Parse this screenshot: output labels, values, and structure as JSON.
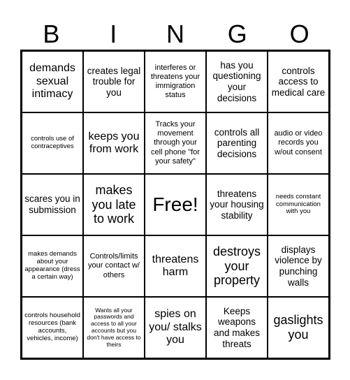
{
  "header": {
    "letters": [
      "B",
      "I",
      "N",
      "G",
      "O"
    ]
  },
  "board": {
    "rows": [
      [
        {
          "text": "demands sexual intimacy"
        },
        {
          "text": "creates legal trouble for you"
        },
        {
          "text": "interferes or threatens your immigration status"
        },
        {
          "text": "has you questioning your decisions"
        },
        {
          "text": "controls access to medical care"
        }
      ],
      [
        {
          "text": "controls use of contraceptives"
        },
        {
          "text": "keeps you from work"
        },
        {
          "text": "Tracks your movement through your cell phone \"for your safety\""
        },
        {
          "text": "controls all parenting decisions"
        },
        {
          "text": "audio or video records you w/out consent"
        }
      ],
      [
        {
          "text": "scares you in submission"
        },
        {
          "text": "makes you late to work"
        },
        {
          "text": "Free!"
        },
        {
          "text": "threatens your housing stability"
        },
        {
          "text": "needs constant communication with you"
        }
      ],
      [
        {
          "text": "makes demands about your appearance (dress a certain way)"
        },
        {
          "text": "Controls/limits your contact w/ others"
        },
        {
          "text": "threatens harm"
        },
        {
          "text": "destroys your property"
        },
        {
          "text": "displays violence by punching walls"
        }
      ],
      [
        {
          "text": "controls household resources (bank accounts, vehicles, income)"
        },
        {
          "text": "Wants all your passwords and access to all your accounts but you don't have access to theirs"
        },
        {
          "text": "spies on you/ stalks you"
        },
        {
          "text": "Keeps weapons and makes threats"
        },
        {
          "text": "gaslights you"
        }
      ]
    ]
  }
}
